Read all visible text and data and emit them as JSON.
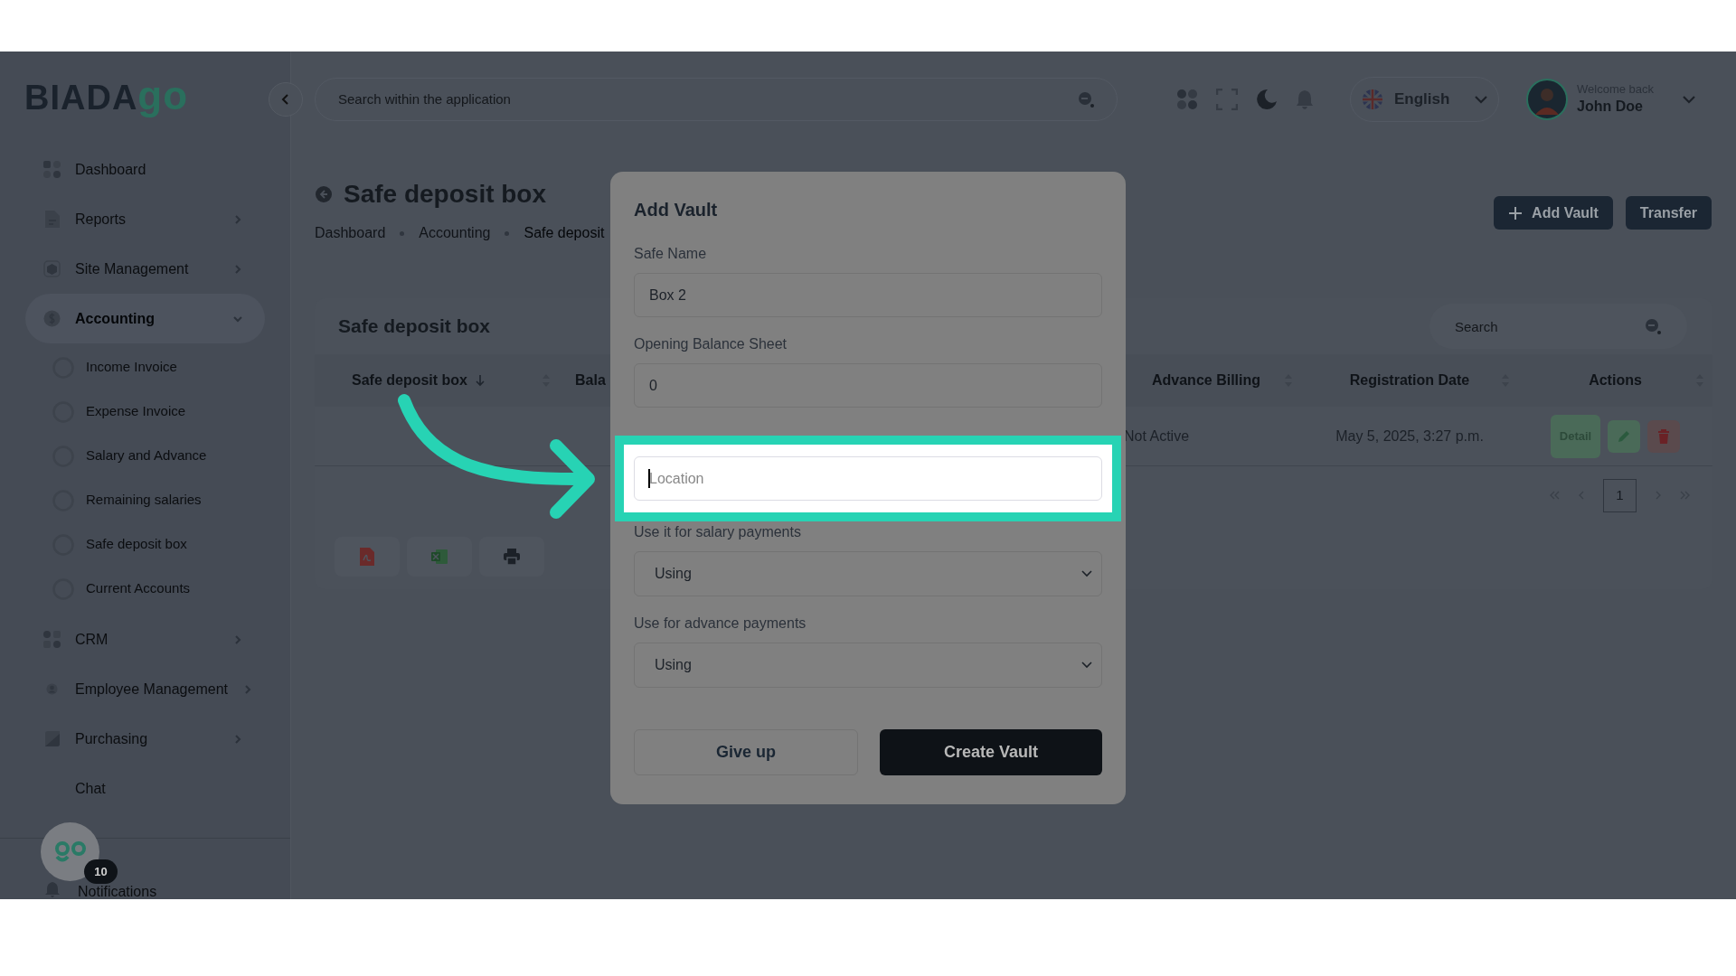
{
  "top_bar": {
    "search": {
      "placeholder": "Search within the application"
    },
    "language": "English",
    "welcome": "Welcome back",
    "user": "John Doe"
  },
  "sidebar": {
    "logo": {
      "text": "BIADA",
      "accent": "go"
    },
    "items": [
      {
        "label": "Dashboard",
        "selected": false
      },
      {
        "label": "Reports",
        "selected": false,
        "expanded": false
      },
      {
        "label": "Site Management",
        "selected": false,
        "expanded": false
      },
      {
        "label": "Accounting",
        "selected": true,
        "expanded": true,
        "children": [
          {
            "label": "Income Invoice"
          },
          {
            "label": "Expense Invoice"
          },
          {
            "label": "Salary and Advance"
          },
          {
            "label": "Remaining salaries"
          },
          {
            "label": "Safe deposit box"
          },
          {
            "label": "Current Accounts"
          }
        ]
      },
      {
        "label": "CRM",
        "selected": false,
        "expanded": false
      },
      {
        "label": "Employee Management",
        "selected": false,
        "expanded": false
      },
      {
        "label": "Purchasing",
        "selected": false,
        "expanded": false
      },
      {
        "label": "Chat",
        "selected": false
      }
    ],
    "chat_badge": "10",
    "footer_item": "Notifications"
  },
  "page": {
    "title": "Safe deposit box",
    "breadcrumbs": [
      "Dashboard",
      "Accounting",
      "Safe deposit"
    ],
    "buttons": [
      {
        "label": "Add Vault",
        "kind": "add"
      },
      {
        "label": "Transfer",
        "kind": "plain"
      }
    ]
  },
  "card": {
    "title": "Safe deposit box",
    "search": {
      "placeholder": "Search"
    },
    "table": {
      "columns": [
        {
          "label": "Safe deposit box"
        },
        {
          "label": "Bala"
        },
        {
          "label": "Advance Billing"
        },
        {
          "label": "Registration Date"
        },
        {
          "label": "Actions"
        }
      ],
      "rows": [
        {
          "cells": [
            "",
            "",
            "Not Active",
            "May 5, 2025, 3:27 p.m."
          ],
          "actions": [
            {
              "kind": "detail",
              "label": "Detail"
            },
            {
              "kind": "edit"
            },
            {
              "kind": "delete"
            }
          ]
        }
      ]
    },
    "pagination": {
      "pages": [
        {
          "label": "1",
          "selected": true
        }
      ]
    },
    "exports": [
      {
        "kind": "pdf"
      },
      {
        "kind": "excel"
      },
      {
        "kind": "print"
      }
    ]
  },
  "modal": {
    "title": "Add Vault",
    "fields": [
      {
        "kind": "text",
        "label": "Safe Name",
        "value": "Box 2",
        "highlighted": false
      },
      {
        "kind": "text",
        "label": "Opening Balance Sheet",
        "value": "0",
        "highlighted": false
      },
      {
        "kind": "text",
        "placeholder": "Location",
        "highlighted": true
      },
      {
        "kind": "select",
        "label": "Use it for salary payments",
        "value": "Using",
        "highlighted": false
      },
      {
        "kind": "select",
        "label": "Use for advance payments",
        "value": "Using",
        "highlighted": false
      }
    ],
    "buttons": [
      {
        "label": "Give up",
        "kind": "secondary"
      },
      {
        "label": "Create Vault",
        "kind": "primary"
      }
    ]
  }
}
